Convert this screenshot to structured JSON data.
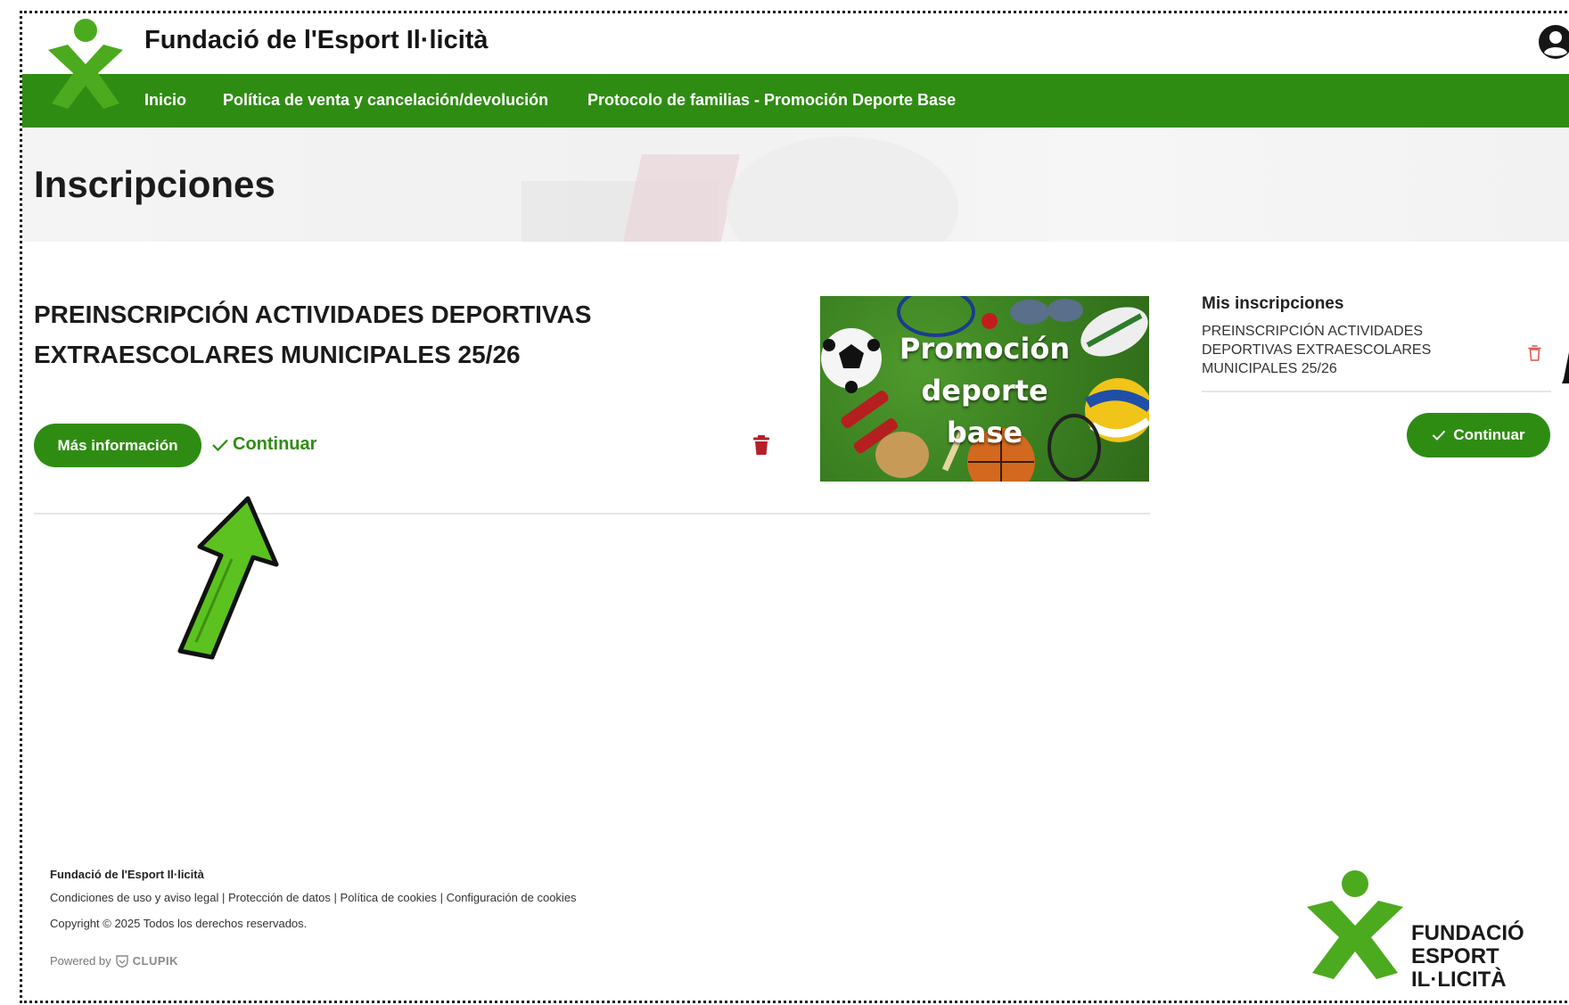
{
  "header": {
    "site_title": "Fundació de l'Esport Il·licità",
    "nav": [
      "Inicio",
      "Política de venta y cancelación/devolución",
      "Protocolo de familias - Promoción Deporte Base"
    ]
  },
  "hero": {
    "title": "Inscripciones"
  },
  "activity": {
    "title_line1": "PREINSCRIPCIÓN ACTIVIDADES DEPORTIVAS",
    "title_line2": "EXTRAESCOLARES MUNICIPALES 25/26",
    "info_button": "Más información",
    "continue_link": "Continuar",
    "promo_line1": "Promoción",
    "promo_line2": "deporte",
    "promo_line3": "base"
  },
  "sidebar": {
    "heading": "Mis inscripciones",
    "item_line1": "PREINSCRIPCIÓN ACTIVIDADES",
    "item_line2": "DEPORTIVAS EXTRAESCOLARES",
    "item_line3": "MUNICIPALES 25/26",
    "continue_button": "Continuar"
  },
  "footer": {
    "org": "Fundació de l'Esport Il·licità",
    "links": [
      "Condiciones de uso y aviso legal",
      "Protección de datos",
      "Política de cookies",
      "Configuración de cookies"
    ],
    "separator": "|",
    "copyright": "Copyright © 2025 Todos los derechos reservados.",
    "powered_by": "Powered by",
    "clupik": "CLUPIK",
    "logo_line1": "FUNDACIÓ",
    "logo_line2": "ESPORT",
    "logo_line3": "IL·LICITÀ"
  },
  "colors": {
    "brand_green": "#2f8c12",
    "logo_green": "#4caa1f",
    "delete_red": "#b3202a",
    "arrow_green": "#5bc21f"
  },
  "icons": [
    "user-circle-icon",
    "logo-x-icon",
    "check-icon",
    "trash-icon",
    "trash-outline-icon",
    "arrow-up-icon",
    "clupik-shield-icon"
  ]
}
